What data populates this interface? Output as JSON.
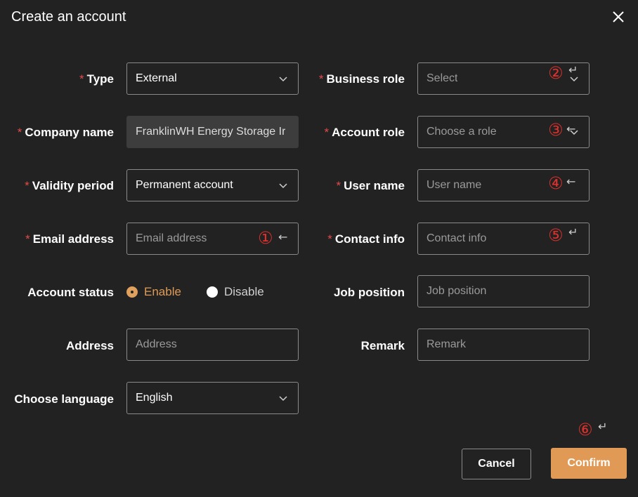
{
  "dialog": {
    "title": "Create an account",
    "required_mark": "*"
  },
  "left": {
    "type": {
      "label": "Type",
      "value": "External"
    },
    "company_name": {
      "label": "Company name",
      "value": "FranklinWH Energy Storage Ir"
    },
    "validity_period": {
      "label": "Validity period",
      "value": "Permanent account"
    },
    "email_address": {
      "label": "Email address",
      "placeholder": "Email address"
    },
    "account_status": {
      "label": "Account status",
      "options": [
        "Enable",
        "Disable"
      ],
      "selected": "Enable"
    },
    "address": {
      "label": "Address",
      "placeholder": "Address"
    },
    "choose_language": {
      "label": "Choose language",
      "value": "English"
    }
  },
  "right": {
    "business_role": {
      "label": "Business role",
      "placeholder": "Select"
    },
    "account_role": {
      "label": "Account role",
      "placeholder": "Choose a role"
    },
    "user_name": {
      "label": "User name",
      "placeholder": "User name"
    },
    "contact_info": {
      "label": "Contact info",
      "placeholder": "Contact info"
    },
    "job_position": {
      "label": "Job position",
      "placeholder": "Job position"
    },
    "remark": {
      "label": "Remark",
      "placeholder": "Remark"
    }
  },
  "annotations": {
    "m1": "①",
    "m2": "②",
    "m3": "③",
    "m4": "④",
    "m5": "⑤",
    "m6": "⑥",
    "arrow": "↵",
    "arrow_left": "←"
  },
  "buttons": {
    "cancel": "Cancel",
    "confirm": "Confirm"
  },
  "colors": {
    "background": "#222222",
    "accent": "#e09a55",
    "required": "#e04b4b",
    "annotation": "#e0302c"
  },
  "icons": {
    "close": "close-icon",
    "dropdown": "chevron-down-icon"
  }
}
